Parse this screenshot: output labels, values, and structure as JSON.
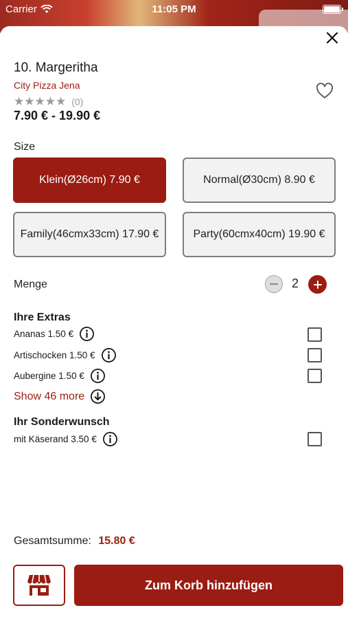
{
  "status_bar": {
    "carrier": "Carrier",
    "time": "11:05 PM"
  },
  "product": {
    "title": "10. Margeritha",
    "restaurant": "City Pizza Jena",
    "stars": "★★★★★",
    "rating_count": "(0)",
    "price_range": "7.90 € - 19.90 €"
  },
  "size": {
    "label": "Size",
    "options": [
      {
        "label": "Klein(Ø26cm) 7.90 €",
        "selected": true
      },
      {
        "label": "Normal(Ø30cm) 8.90 €",
        "selected": false
      },
      {
        "label": "Family(46cmx33cm) 17.90 €",
        "selected": false
      },
      {
        "label": "Party(60cmx40cm) 19.90 €",
        "selected": false
      }
    ]
  },
  "quantity": {
    "label": "Menge",
    "value": "2"
  },
  "extras": {
    "title": "Ihre Extras",
    "items": [
      {
        "label": "Ananas 1.50 €",
        "checked": false
      },
      {
        "label": "Artischocken 1.50 €",
        "checked": false
      },
      {
        "label": "Aubergine 1.50 €",
        "checked": false
      }
    ],
    "show_more": "Show 46 more"
  },
  "special": {
    "title": "Ihr Sonderwunsch",
    "items": [
      {
        "label": "mit Käserand 3.50 €",
        "checked": false
      }
    ]
  },
  "total": {
    "label": "Gesamtsumme:",
    "amount": "15.80 €"
  },
  "actions": {
    "add_to_cart": "Zum Korb hinzufügen"
  },
  "colors": {
    "accent": "#9b1c13",
    "border": "#7d7d7d",
    "button_bg": "#f2f2f2"
  }
}
